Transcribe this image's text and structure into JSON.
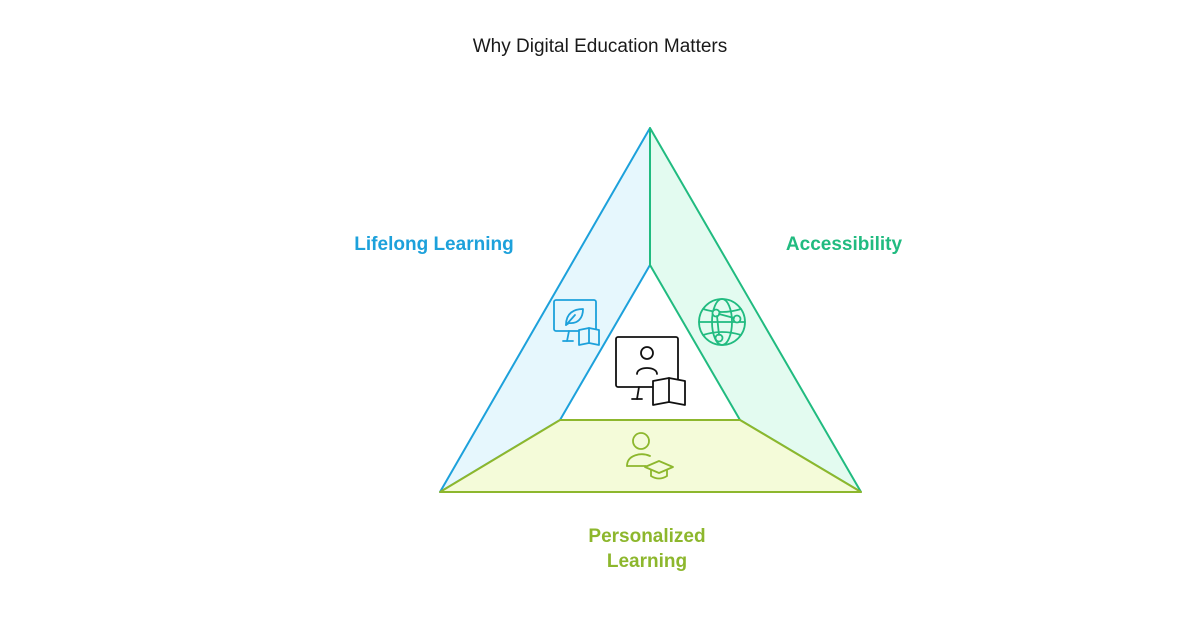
{
  "title": "Why Digital Education Matters",
  "segments": [
    {
      "id": "left",
      "label_lines": [
        "Lifelong Learning"
      ],
      "color": "#1da1db",
      "fill": "#e6f7fd",
      "icon": "monitor-book-leaf-icon"
    },
    {
      "id": "right",
      "label_lines": [
        "Accessibility"
      ],
      "color": "#21bb80",
      "fill": "#e3fbf0",
      "icon": "globe-network-icon"
    },
    {
      "id": "bottom",
      "label_lines": [
        "Personalized",
        "Learning"
      ],
      "color": "#8db72d",
      "fill": "#f4fbd9",
      "icon": "student-graduation-cap-icon"
    }
  ],
  "center": {
    "icon": "monitor-person-book-icon",
    "color": "#111111"
  }
}
